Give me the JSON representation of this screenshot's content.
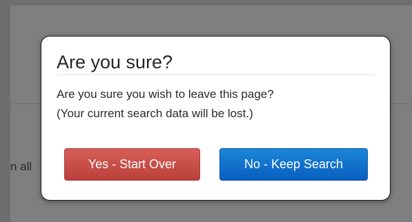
{
  "background": {
    "partial_text": "n all"
  },
  "dialog": {
    "title": "Are you sure?",
    "message_line1": "Are you sure you wish to leave this page?",
    "message_line2": "(Your current search data will be lost.)",
    "confirm_label": "Yes - Start Over",
    "cancel_label": "No - Keep Search"
  },
  "colors": {
    "overlay": "#7f7f7f",
    "confirm_button": "#c94c46",
    "cancel_button": "#0f6fcc"
  }
}
